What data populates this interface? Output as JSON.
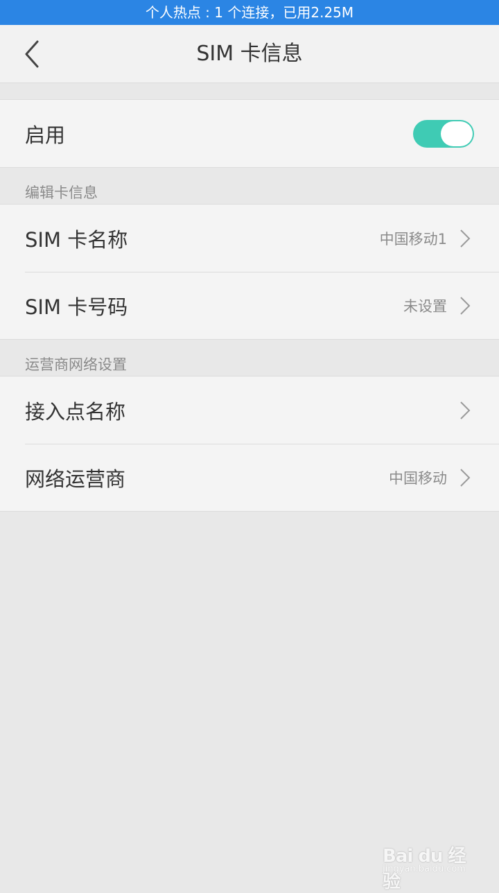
{
  "status_bar": {
    "text": "个人热点 : 1 个连接，已用2.25M"
  },
  "header": {
    "title": "SIM 卡信息",
    "back_icon": "chevron-left-icon"
  },
  "enable_section": {
    "label": "启用",
    "toggle_on": true,
    "accent_color": "#3fcbb4"
  },
  "edit_section": {
    "heading": "编辑卡信息",
    "items": [
      {
        "label": "SIM 卡名称",
        "value": "中国移动1"
      },
      {
        "label": "SIM 卡号码",
        "value": "未设置"
      }
    ]
  },
  "carrier_section": {
    "heading": "运营商网络设置",
    "items": [
      {
        "label": "接入点名称",
        "value": ""
      },
      {
        "label": "网络运营商",
        "value": "中国移动"
      }
    ]
  },
  "watermark": {
    "brand": "Bai du 经验",
    "url": "jingyan.baidu.com"
  }
}
